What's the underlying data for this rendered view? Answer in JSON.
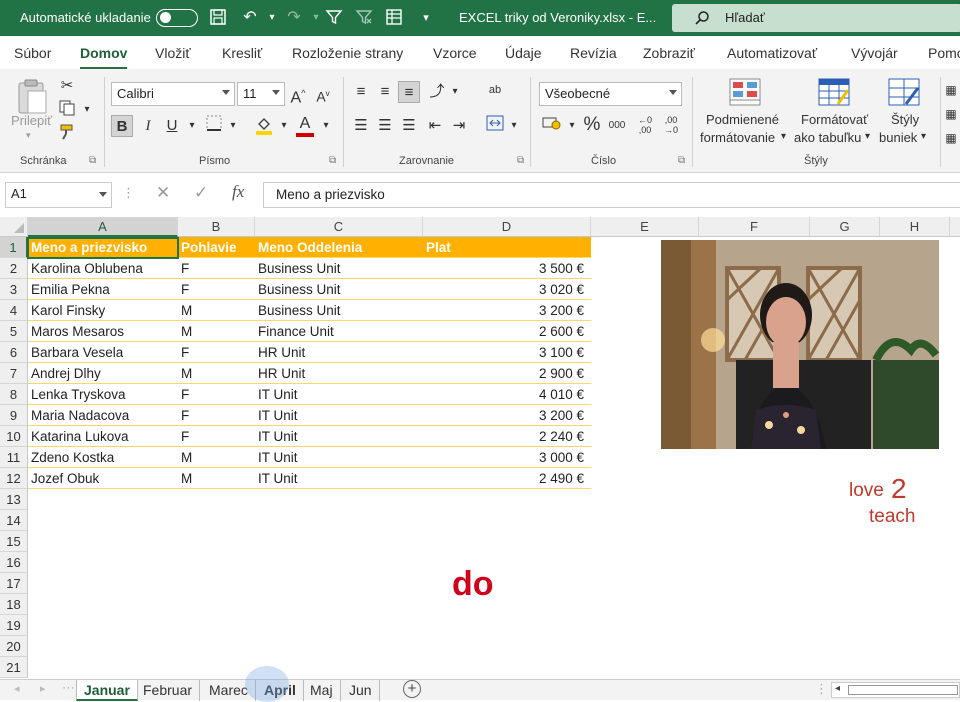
{
  "titlebar": {
    "autosave_label": "Automatické ukladanie",
    "file_title": "EXCEL triky od Veroniky.xlsx  -  E...",
    "search_placeholder": "Hľadať"
  },
  "ribbon_tabs": [
    "Súbor",
    "Domov",
    "Vložiť",
    "Kresliť",
    "Rozloženie strany",
    "Vzorce",
    "Údaje",
    "Revízia",
    "Zobraziť",
    "Automatizovať",
    "Vývojár",
    "Pomo"
  ],
  "ribbon": {
    "paste_label": "Prilepiť",
    "font_name": "Calibri",
    "font_size": "11",
    "number_format": "Všeobecné",
    "bold_label": "B",
    "italic_label": "I",
    "underline_label": "U",
    "percent_label": "%",
    "thousands_label": "000",
    "conditional_label_1": "Podmienené",
    "conditional_label_2": "formátovanie",
    "format_table_label_1": "Formátovať",
    "format_table_label_2": "ako tabuľku",
    "cell_styles_label_1": "Štýly",
    "cell_styles_label_2": "buniek",
    "groups": {
      "clipboard": "Schránka",
      "font": "Písmo",
      "alignment": "Zarovnanie",
      "number": "Číslo",
      "styles": "Štýly"
    },
    "accent_fill": "#ffd500",
    "accent_font": "#d00000"
  },
  "formula_bar": {
    "name_box": "A1",
    "fx_label": "fx",
    "content": "Meno a priezvisko"
  },
  "columns": [
    "A",
    "B",
    "C",
    "D",
    "E",
    "F",
    "G",
    "H"
  ],
  "rows": [
    "1",
    "2",
    "3",
    "4",
    "5",
    "6",
    "7",
    "8",
    "9",
    "10",
    "11",
    "12",
    "13",
    "14",
    "15",
    "16",
    "17",
    "18",
    "19",
    "20",
    "21"
  ],
  "table": {
    "headers": [
      "Meno a priezvisko",
      "Pohlavie",
      "Meno Oddelenia",
      "Plat"
    ],
    "data": [
      [
        "Karolina Oblubena",
        "F",
        "Business Unit",
        "3 500 €"
      ],
      [
        "Emilia Pekna",
        "F",
        "Business Unit",
        "3 020 €"
      ],
      [
        "Karol Finsky",
        "M",
        "Business Unit",
        "3 200 €"
      ],
      [
        "Maros Mesaros",
        "M",
        "Finance Unit",
        "2 600 €"
      ],
      [
        "Barbara Vesela",
        "F",
        "HR Unit",
        "3 100 €"
      ],
      [
        "Andrej Dlhy",
        "M",
        "HR Unit",
        "2 900 €"
      ],
      [
        "Lenka Tryskova",
        "F",
        "IT Unit",
        "4 010 €"
      ],
      [
        "Maria Nadacova",
        "F",
        "IT Unit",
        "3 200 €"
      ],
      [
        "Katarina Lukova",
        "F",
        "IT Unit",
        "2 240 €"
      ],
      [
        "Zdeno Kostka",
        "M",
        "IT Unit",
        "3 000 €"
      ],
      [
        "Jozef Obuk",
        "M",
        "IT Unit",
        "2 490 €"
      ]
    ],
    "header_color": "#ffb000"
  },
  "overlay": {
    "caption": "do",
    "logo_line1": "love",
    "logo_number": "2",
    "logo_line2": "teach",
    "caption_color": "#d0021b"
  },
  "sheet_tabs": [
    "Januar",
    "Februar",
    "Marec",
    "April",
    "Maj",
    "Jun"
  ],
  "active_sheet": "Januar"
}
